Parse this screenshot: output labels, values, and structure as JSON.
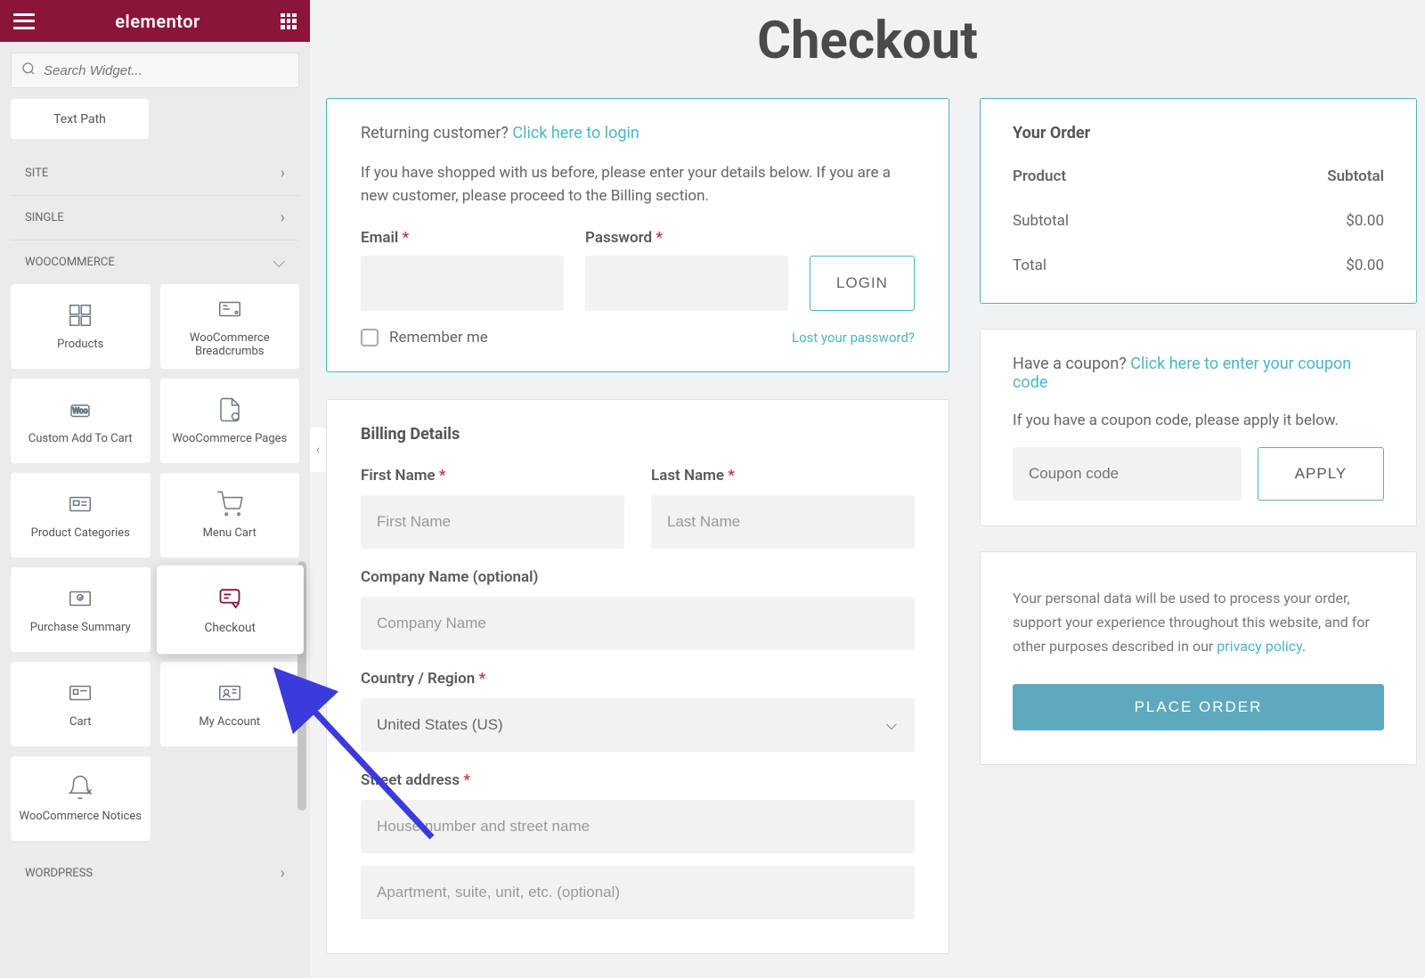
{
  "sidebar": {
    "brand": "elementor",
    "search_placeholder": "Search Widget...",
    "text_path": "Text Path",
    "categories": {
      "site": "SITE",
      "single": "SINGLE",
      "woo": "WOOCOMMERCE",
      "wp": "WORDPRESS"
    },
    "widgets": {
      "products": "Products",
      "breadcrumbs": "WooCommerce Breadcrumbs",
      "custom_cart": "Custom Add To Cart",
      "pages": "WooCommerce Pages",
      "categories": "Product Categories",
      "menu_cart": "Menu Cart",
      "purchase_summary": "Purchase Summary",
      "checkout": "Checkout",
      "cart": "Cart",
      "my_account": "My Account",
      "notices": "WooCommerce Notices"
    }
  },
  "page": {
    "title": "Checkout"
  },
  "login": {
    "returning_prefix": "Returning customer? ",
    "returning_link": "Click here to login",
    "info": "If you have shopped with us before, please enter your details below. If you are a new customer, please proceed to the Billing section.",
    "email_label": "Email ",
    "password_label": "Password ",
    "login_btn": "LOGIN",
    "remember": "Remember me",
    "lost": "Lost your password?"
  },
  "billing": {
    "heading": "Billing Details",
    "first_name_label": "First Name ",
    "first_name_ph": "First Name",
    "last_name_label": "Last Name ",
    "last_name_ph": "Last Name",
    "company_label": "Company Name (optional)",
    "company_ph": "Company Name",
    "country_label": "Country / Region ",
    "country_value": "United States (US)",
    "street_label": "Street address ",
    "street_ph1": "House number and street name",
    "street_ph2": "Apartment, suite, unit, etc. (optional)"
  },
  "order": {
    "heading": "Your Order",
    "product_label": "Product",
    "subtotal_label": "Subtotal",
    "subtotal_row": "Subtotal",
    "subtotal_value": "$0.00",
    "total_label": "Total",
    "total_value": "$0.00"
  },
  "coupon": {
    "prefix": "Have a coupon? ",
    "link": "Click here to enter your coupon code",
    "info": "If you have a coupon code, please apply it below.",
    "placeholder": "Coupon code",
    "apply": "APPLY"
  },
  "privacy": {
    "text_prefix": "Your personal data will be used to process your order, support your experience throughout this website, and for other purposes described in our ",
    "link": "privacy policy",
    "place_order": "PLACE ORDER"
  }
}
